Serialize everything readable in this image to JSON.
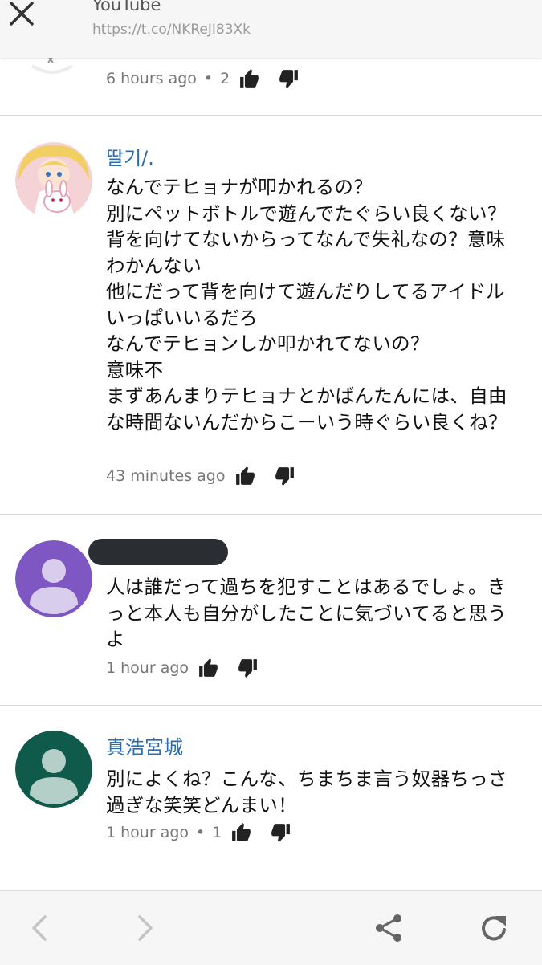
{
  "header": {
    "title": "YouTube",
    "url": "https://t.co/NKReJI83Xk"
  },
  "comments": [
    {
      "author": "",
      "body": "",
      "time": "6 hours ago",
      "likes": "2"
    },
    {
      "author": "딸기/.",
      "body": "なんでテヒョナが叩かれるの？\n別にペットボトルで遊んでたぐらい良くない？背を向けてないからってなんで失礼なの？意味わかんない\n他にだって背を向けて遊んだりしてるアイドルいっぱいいるだろ\nなんでテヒョンしか叩かれてないの？\n意味不\nまずあんまりテヒョナとかばんたんには、自由な時間ないんだからこーいう時ぐらい良くね？",
      "time": "43 minutes ago",
      "likes": ""
    },
    {
      "author": "",
      "body": "人は誰だって過ちを犯すことはあるでしょ。きっと本人も自分がしたことに気づいてると思うよ",
      "time": "1 hour ago",
      "likes": ""
    },
    {
      "author": "真浩宮城",
      "body": "別によくね？こんな、ちまちま言う奴器ちっさ過ぎな笑笑どんまい！",
      "time": "1 hour ago",
      "likes": "1"
    }
  ],
  "icons": {
    "close": "close-icon",
    "like": "thumbs-up-icon",
    "dislike": "thumbs-down-icon",
    "back": "chevron-left-icon",
    "forward": "chevron-right-icon",
    "share": "share-icon",
    "refresh": "refresh-icon"
  },
  "colors": {
    "author_link": "#2b6db0",
    "avatar_purple": "#7e57c2",
    "avatar_green": "#0f5a4a",
    "redaction": "#2a2d31"
  }
}
